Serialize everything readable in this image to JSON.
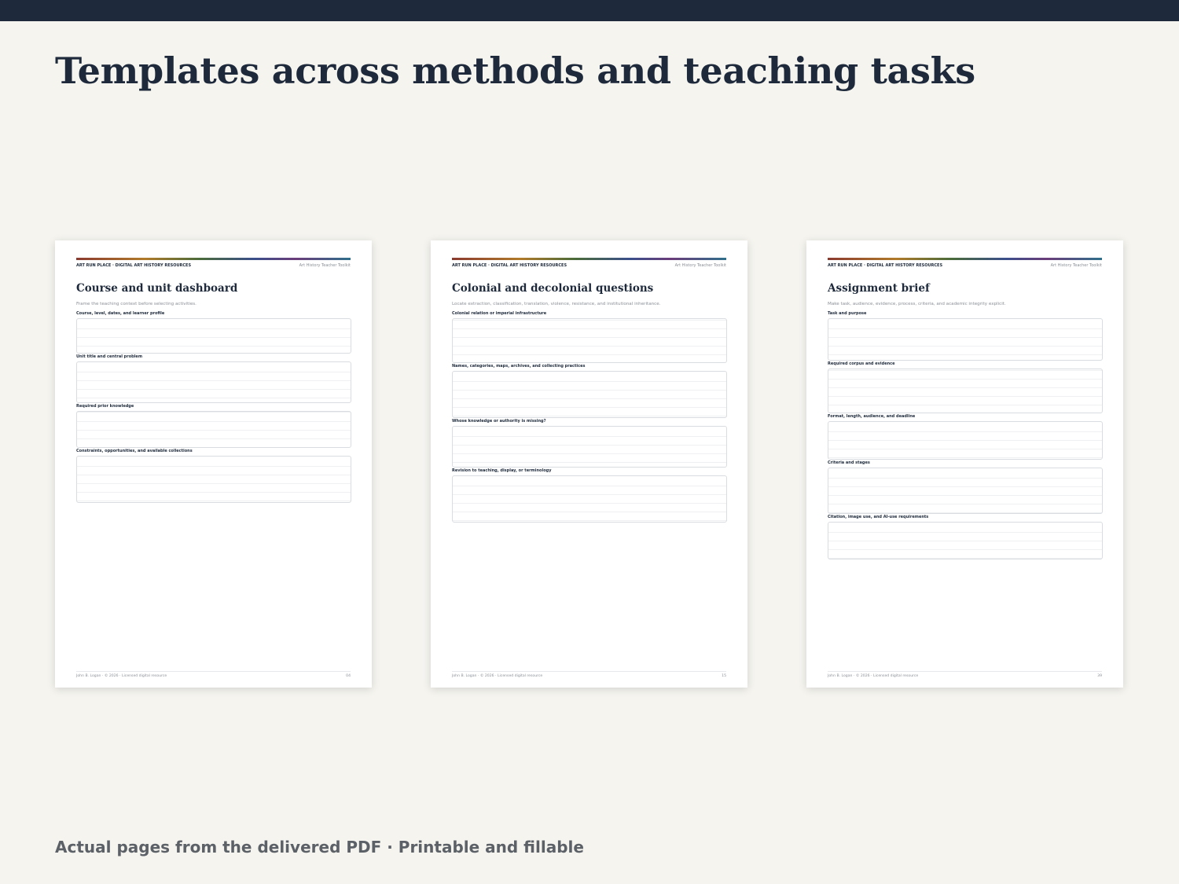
{
  "headline": "Templates across methods and teaching tasks",
  "caption": "Actual pages from the delivered PDF · Printable and fillable",
  "pages": [
    {
      "brand": "ART RUN PLACE · DIGITAL ART HISTORY RESOURCES",
      "toolkit": "Art History Teacher Toolkit",
      "title": "Course and unit dashboard",
      "subtitle": "Frame the teaching context before selecting activities.",
      "fields": [
        "Course, level, dates, and learner profile",
        "Unit title and central problem",
        "Required prior knowledge",
        "Constraints, opportunities, and available collections"
      ],
      "footer_left": "John B. Logan · © 2026 · Licensed digital resource",
      "footer_right": "04"
    },
    {
      "brand": "ART RUN PLACE · DIGITAL ART HISTORY RESOURCES",
      "toolkit": "Art History Teacher Toolkit",
      "title": "Colonial and decolonial questions",
      "subtitle": "Locate extraction, classification, translation, violence, resistance, and institutional inheritance.",
      "fields": [
        "Colonial relation or imperial infrastructure",
        "Names, categories, maps, archives, and collecting practices",
        "Whose knowledge or authority is missing?",
        "Revision to teaching, display, or terminology"
      ],
      "footer_left": "John B. Logan · © 2026 · Licensed digital resource",
      "footer_right": "15"
    },
    {
      "brand": "ART RUN PLACE · DIGITAL ART HISTORY RESOURCES",
      "toolkit": "Art History Teacher Toolkit",
      "title": "Assignment brief",
      "subtitle": "Make task, audience, evidence, process, criteria, and academic integrity explicit.",
      "fields": [
        "Task and purpose",
        "Required corpus and evidence",
        "Format, length, audience, and deadline",
        "Criteria and stages",
        "Citation, image use, and AI-use requirements"
      ],
      "footer_left": "John B. Logan · © 2026 · Licensed digital resource",
      "footer_right": "39"
    }
  ]
}
